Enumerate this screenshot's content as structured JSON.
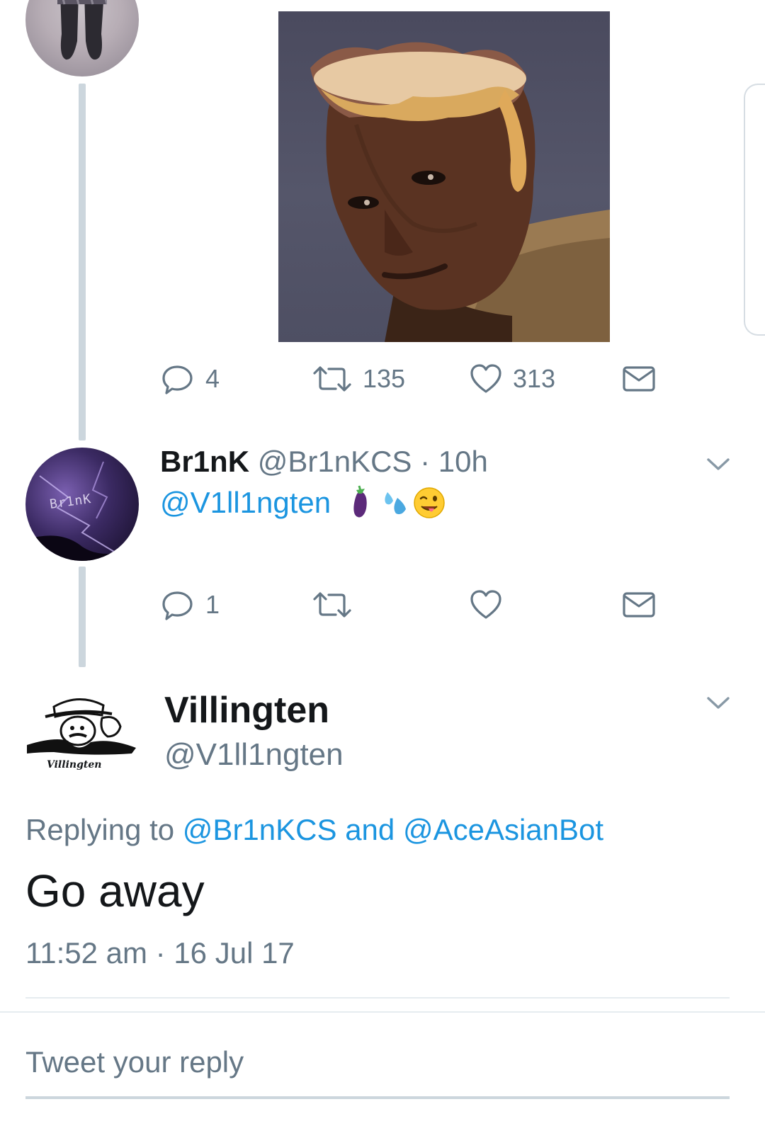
{
  "colors": {
    "link": "#1b95e0",
    "muted": "#657786",
    "text": "#14171a",
    "thread_line": "#ccd6dd"
  },
  "top_tweet": {
    "media_alt_icon": "image-media",
    "actions": {
      "reply_count": "4",
      "retweet_count": "135",
      "like_count": "313"
    }
  },
  "brink_tweet": {
    "display_name": "Br1nK",
    "handle": "@Br1nKCS",
    "separator": "·",
    "time": "10h",
    "mention": "@V1ll1ngten",
    "emojis": [
      "eggplant-emoji",
      "sweat-droplets-emoji",
      "winking-tongue-emoji"
    ],
    "avatar_text": "Br1nK",
    "actions": {
      "reply_count": "1",
      "retweet_count": "",
      "like_count": ""
    }
  },
  "main_tweet": {
    "display_name": "Villingten",
    "handle": "@V1ll1ngten",
    "avatar_text": "Villingten",
    "replying_prefix": "Replying to",
    "reply_target_1": "@Br1nKCS",
    "reply_and": "and",
    "reply_target_2": "@AceAsianBot",
    "body": "Go away",
    "timestamp": "11:52 am · 16 Jul 17"
  },
  "composer": {
    "placeholder": "Tweet your reply"
  }
}
